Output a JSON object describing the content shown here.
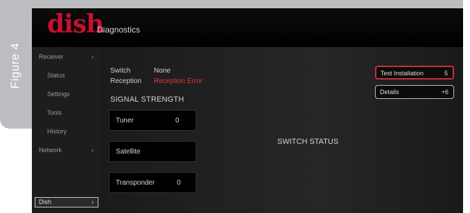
{
  "figure_label": "Figure 4",
  "logo_text": "dish",
  "app_title": "Diagnostics",
  "sidebar": {
    "items": [
      {
        "label": "Receiver",
        "arrow": "›"
      },
      {
        "label": "Status"
      },
      {
        "label": "Settings"
      },
      {
        "label": "Tools"
      },
      {
        "label": "History"
      },
      {
        "label": "Network",
        "arrow": "›"
      },
      {
        "label": "Dish",
        "arrow": "›",
        "selected": true
      }
    ]
  },
  "main": {
    "switch_label": "Switch",
    "switch_value": "None",
    "reception_label": "Reception",
    "reception_value": "Reception Error",
    "signal_strength_heading": "SIGNAL STRENGTH",
    "signal": {
      "tuner_label": "Tuner",
      "tuner_value": "0",
      "satellite_label": "Satellite",
      "transponder_label": "Transponder",
      "transponder_value": "0"
    },
    "switch_status_heading": "SWITCH STATUS"
  },
  "actions": {
    "test_installation_label": "Test Installation",
    "test_installation_value": "5",
    "details_label": "Details",
    "details_value": "+6"
  },
  "colors": {
    "brand": "#c8102e",
    "error": "#e03a3a",
    "frame": "#bcbdc0"
  }
}
